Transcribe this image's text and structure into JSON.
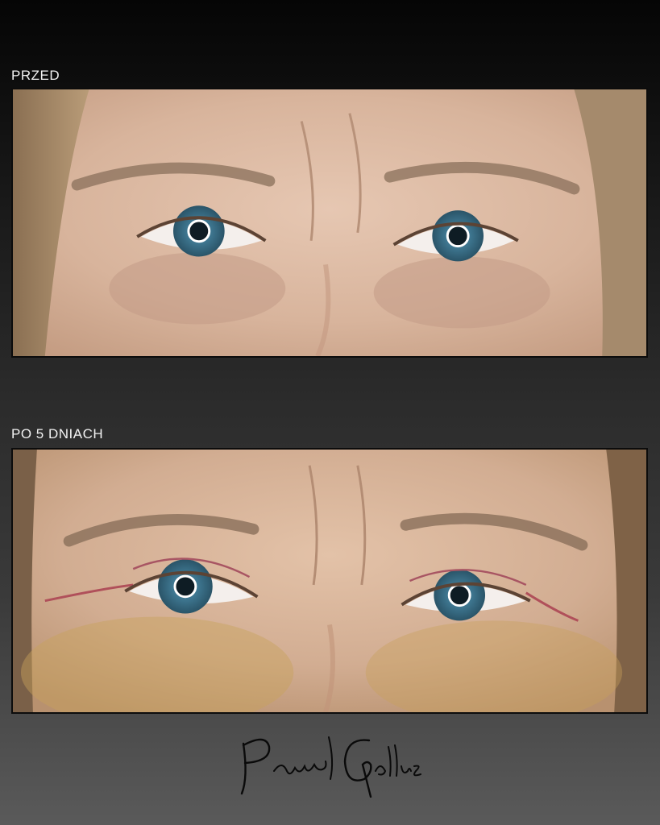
{
  "panels": {
    "before_label": "PRZED",
    "after_label": "PO 5 DNIACH"
  },
  "signature": {
    "text": "Paweł Gollus"
  },
  "colors": {
    "background_top": "#050505",
    "background_bottom": "#5a5a5a",
    "label_text": "#f2f2f2",
    "iris": "#4a7f98"
  }
}
